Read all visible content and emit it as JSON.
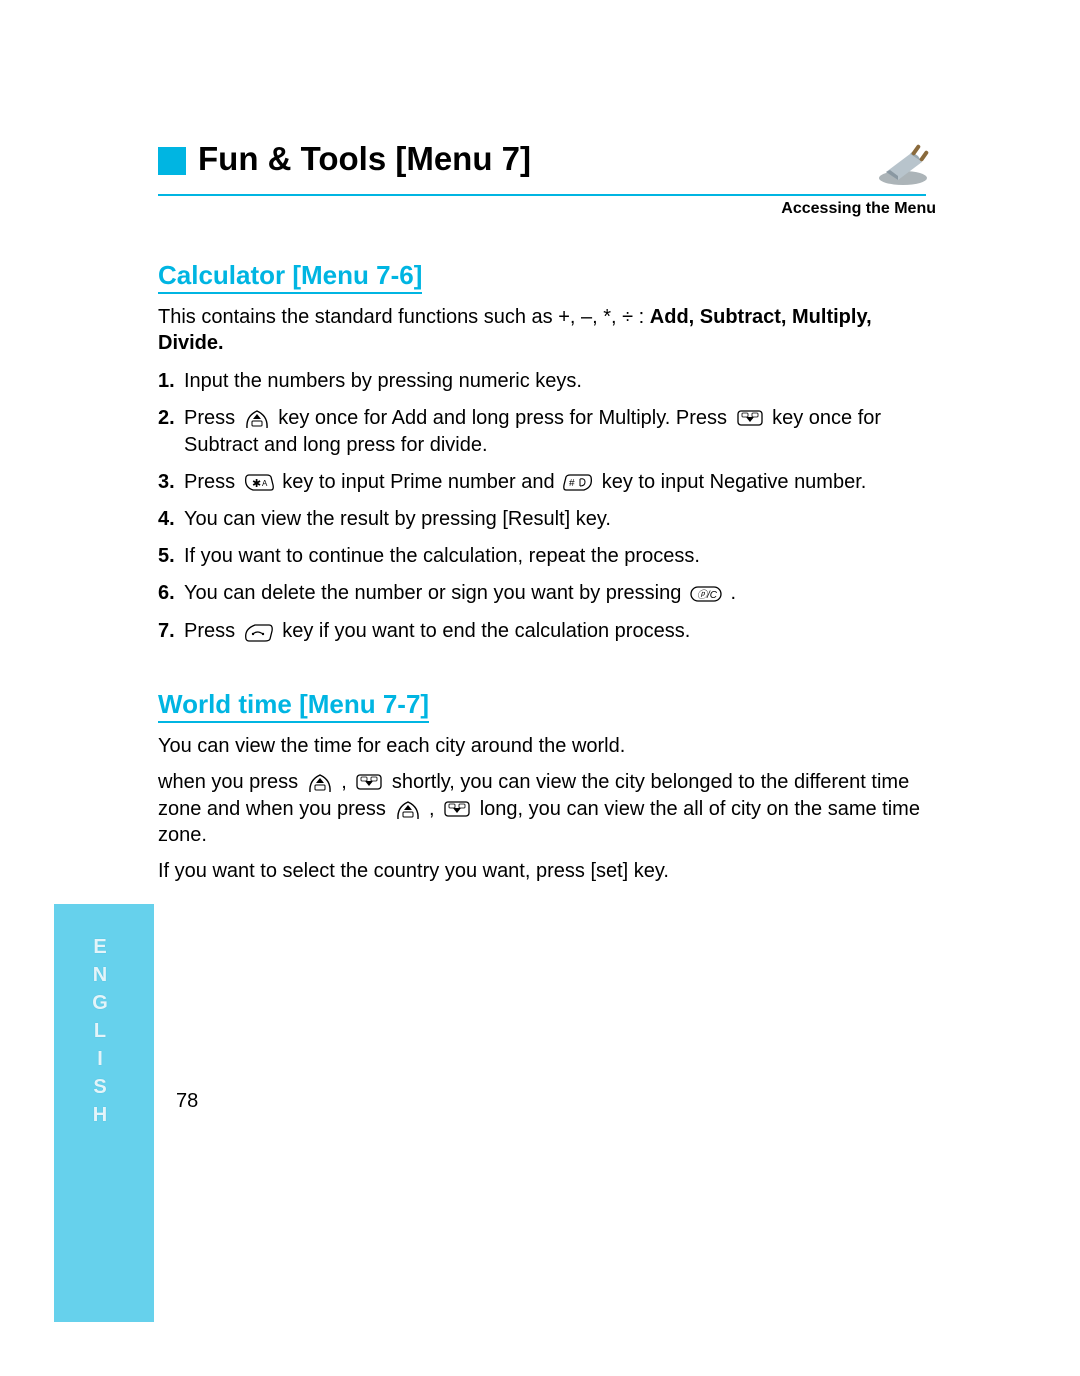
{
  "header": {
    "title": "Fun & Tools [Menu 7]",
    "subtitle": "Accessing the Menu",
    "decorative_icon": "plug-3d-icon"
  },
  "sections": [
    {
      "heading": "Calculator [Menu 7-6]",
      "intro_plain": "This contains the standard functions such as +, –, *, ÷ : ",
      "intro_bold": "Add, Subtract, Multiply, Divide.",
      "steps": [
        {
          "n": "1.",
          "parts": [
            {
              "t": "Input the numbers by pressing numeric keys."
            }
          ]
        },
        {
          "n": "2.",
          "parts": [
            {
              "t": "Press "
            },
            {
              "icon": "up-key-icon"
            },
            {
              "t": " key once for Add and long press for Multiply. Press "
            },
            {
              "icon": "down-key-icon"
            },
            {
              "t": " key once for Subtract and long press for divide."
            }
          ]
        },
        {
          "n": "3.",
          "parts": [
            {
              "t": "Press "
            },
            {
              "icon": "star-key-icon"
            },
            {
              "t": " key to input Prime number and "
            },
            {
              "icon": "hash-key-icon"
            },
            {
              "t": " key to input Negative number."
            }
          ]
        },
        {
          "n": "4.",
          "parts": [
            {
              "t": "You can view the result by pressing [Result] key."
            }
          ]
        },
        {
          "n": "5.",
          "parts": [
            {
              "t": "If you want to continue the calculation, repeat the process."
            }
          ]
        },
        {
          "n": "6.",
          "parts": [
            {
              "t": "You can delete the number or sign you want by pressing "
            },
            {
              "icon": "clear-key-icon"
            },
            {
              "t": " ."
            }
          ]
        },
        {
          "n": "7.",
          "parts": [
            {
              "t": "Press "
            },
            {
              "icon": "end-key-icon"
            },
            {
              "t": " key if you want to end the calculation process."
            }
          ]
        }
      ]
    },
    {
      "heading": "World time [Menu 7-7]",
      "paragraphs": [
        {
          "parts": [
            {
              "t": "You can view the time for each city around the world."
            }
          ]
        },
        {
          "parts": [
            {
              "t": "when you press "
            },
            {
              "icon": "up-key-icon"
            },
            {
              "t": " , "
            },
            {
              "icon": "down-key-icon"
            },
            {
              "t": " shortly, you can view the city belonged to the different time zone and when you press "
            },
            {
              "icon": "up-key-icon"
            },
            {
              "t": " , "
            },
            {
              "icon": "down-key-icon"
            },
            {
              "t": " long, you can view the all of city on the same time zone."
            }
          ]
        },
        {
          "parts": [
            {
              "t": "If you want to select the country you want, press [set] key."
            }
          ]
        }
      ]
    }
  ],
  "footer": {
    "language_label": "ENGLISH",
    "page_number": "78"
  },
  "colors": {
    "accent": "#00b5e2",
    "tab": "#66d1ec"
  }
}
